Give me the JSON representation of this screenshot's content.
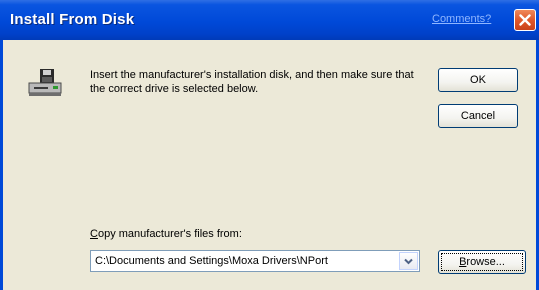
{
  "window": {
    "title": "Install From Disk",
    "comments_link": "Comments?",
    "close_icon": "close-icon"
  },
  "dialog": {
    "icon": "floppy-disk-drive-icon",
    "message": "Insert the manufacturer's installation disk, and then make sure that the correct drive is selected below.",
    "ok_label": "OK",
    "cancel_label": "Cancel",
    "copy_label_rest": "opy manufacturer's files from:",
    "copy_label_accel": "C",
    "path_value": "C:\\Documents and Settings\\Moxa Drivers\\NPort",
    "browse_accel": "B",
    "browse_rest": "rowse..."
  },
  "colors": {
    "titlebar": "#0049d8",
    "dialog_bg": "#ece9d8",
    "close_button": "#e0582a",
    "button_border": "#003c74"
  }
}
